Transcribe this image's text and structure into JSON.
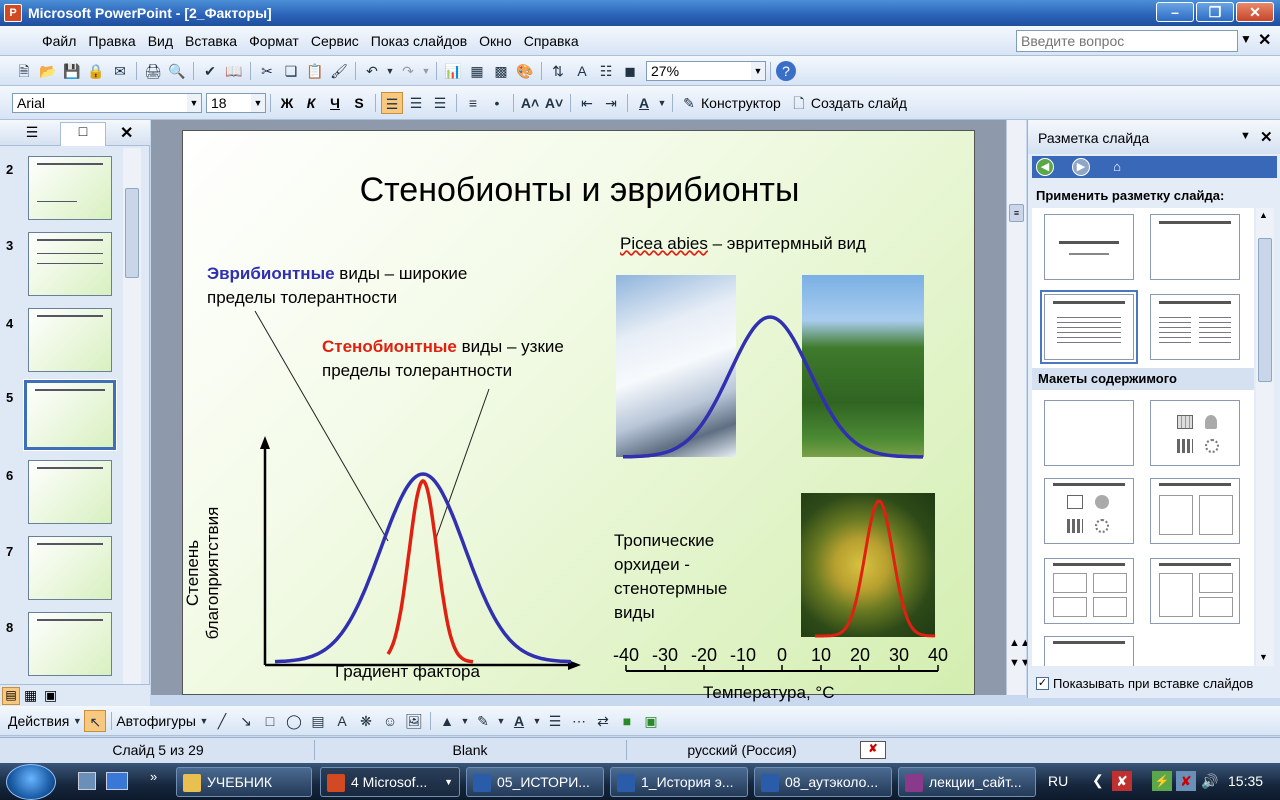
{
  "window": {
    "title": "Microsoft PowerPoint - [2_Факторы]",
    "app_icon": "P"
  },
  "menu": {
    "items": [
      "Файл",
      "Правка",
      "Вид",
      "Вставка",
      "Формат",
      "Сервис",
      "Показ слайдов",
      "Окно",
      "Справка"
    ],
    "help_placeholder": "Введите вопрос"
  },
  "standard_toolbar": {
    "zoom": "27%"
  },
  "format_toolbar": {
    "font": "Arial",
    "size": "18",
    "bold": "Ж",
    "italic": "К",
    "underline": "Ч",
    "shadow": "S",
    "designer": "Конструктор",
    "new_slide": "Создать слайд"
  },
  "thumbs": {
    "numbers": [
      "2",
      "3",
      "4",
      "5",
      "6",
      "7",
      "8"
    ],
    "selected": "5"
  },
  "slide": {
    "title": "Стенобионты и эврибионты",
    "eury_word": "Эврибионтные",
    "eury_rest": " виды – широкие",
    "eury_line2": "пределы толерантности",
    "steno_word": "Стенобионтные",
    "steno_rest": " виды – узкие",
    "steno_line2": "пределы толерантности",
    "picea_latin": "Picea abies",
    "picea_rest": " – эвритермный вид",
    "orchid_l1": "Тропические",
    "orchid_l2": "орхидеи -",
    "orchid_l3": "стенотермные",
    "orchid_l4": "виды",
    "ylabel_l1": "Степень",
    "ylabel_l2": "благоприятствия",
    "xlabel": "Градиент фактора",
    "temp_ticks": [
      "-40",
      "-30",
      "-20",
      "-10",
      "0",
      "10",
      "20",
      "30",
      "40"
    ],
    "temp_label": "Температура, °С",
    "colors": {
      "eury": "#3030b0",
      "steno": "#e02010"
    }
  },
  "task_pane": {
    "title": "Разметка слайда",
    "apply_label": "Применить разметку слайда:",
    "content_section": "Макеты содержимого",
    "show_on_insert": "Показывать при вставке слайдов"
  },
  "draw_toolbar": {
    "actions": "Действия",
    "autoshapes": "Автофигуры"
  },
  "status": {
    "slide": "Слайд 5 из 29",
    "design": "Blank",
    "language": "русский (Россия)"
  },
  "taskbar": {
    "items": [
      "УЧЕБНИК",
      "4 Microsof...",
      "05_ИСТОРИ...",
      "1_История э...",
      "08_аутэколо...",
      "лекции_сайт..."
    ],
    "lang": "RU",
    "clock": "15:35"
  }
}
